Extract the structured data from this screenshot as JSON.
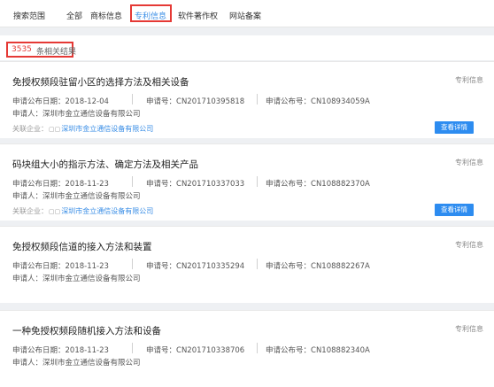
{
  "search_scope": {
    "label": "搜索范围",
    "tabs": [
      {
        "label": "全部"
      },
      {
        "label": "商标信息"
      },
      {
        "label": "专利信息"
      },
      {
        "label": "软件著作权"
      },
      {
        "label": "网站备案"
      }
    ],
    "active_tab": "专利信息",
    "accent_color": "#3a8ee6",
    "highlight_color": "#e53935"
  },
  "results": {
    "count": "3535",
    "suffix": "条相关结果"
  },
  "labels": {
    "type": "专利信息",
    "pub_date": "申请公布日期：",
    "app_no": "申请号：",
    "pub_no": "申请公布号：",
    "applicant": "申请人：",
    "assoc": "关联企业：",
    "detail_button": "查看详情"
  },
  "patents": [
    {
      "title": "免授权频段驻留小区的选择方法及相关设备",
      "pub_date": "2018-12-04",
      "app_no": "CN201710395818",
      "pub_no": "CN108934059A",
      "applicant": "深圳市金立通信设备有限公司",
      "assoc": "深圳市金立通信设备有限公司"
    },
    {
      "title": "码块组大小的指示方法、确定方法及相关产品",
      "pub_date": "2018-11-23",
      "app_no": "CN201710337033",
      "pub_no": "CN108882370A",
      "applicant": "深圳市金立通信设备有限公司",
      "assoc": "深圳市金立通信设备有限公司"
    },
    {
      "title": "免授权频段信道的接入方法和装置",
      "pub_date": "2018-11-23",
      "app_no": "CN201710335294",
      "pub_no": "CN108882267A",
      "applicant": "深圳市金立通信设备有限公司",
      "assoc": ""
    },
    {
      "title": "一种免授权频段随机接入方法和设备",
      "pub_date": "2018-11-23",
      "app_no": "CN201710338706",
      "pub_no": "CN108882340A",
      "applicant": "深圳市金立通信设备有限公司",
      "assoc": ""
    }
  ]
}
